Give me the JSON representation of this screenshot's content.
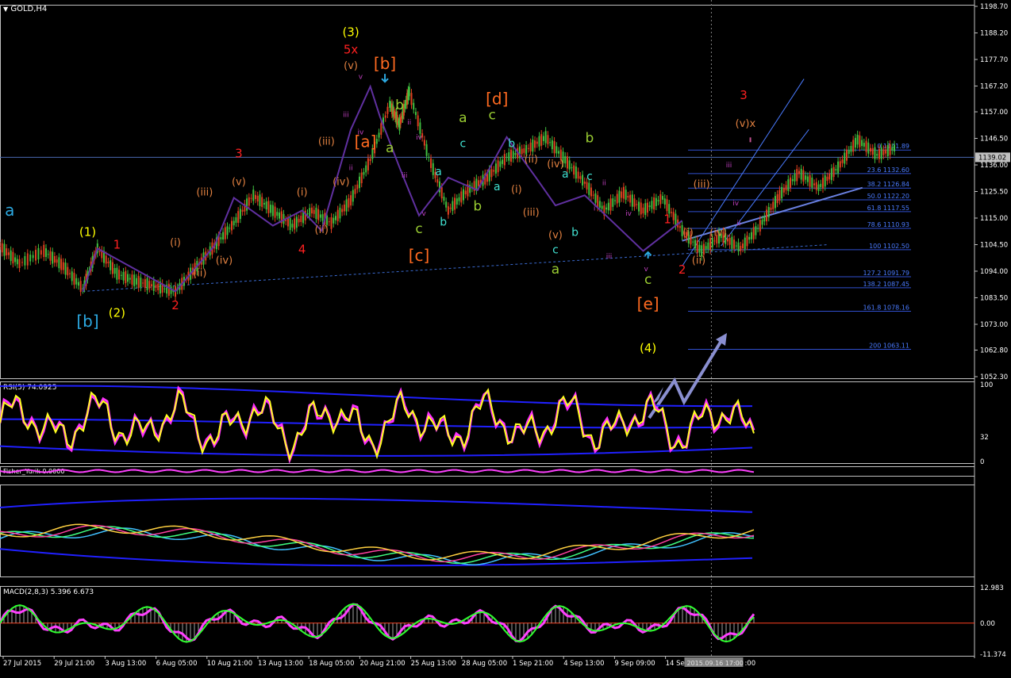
{
  "chart_data": [
    {
      "type": "line",
      "title": "GOLD,H4",
      "symbol": "GOLD",
      "timeframe": "H4",
      "price_axis": {
        "labels": [
          "1198.70",
          "1188.20",
          "1177.70",
          "1167.20",
          "1157.00",
          "1146.50",
          "1136.00",
          "1125.50",
          "1115.00",
          "1104.50",
          "1094.00",
          "1083.50",
          "1073.00",
          "1062.80",
          "1052.30"
        ],
        "min": 1052.3,
        "max": 1198.7
      },
      "current_price": "1139.02",
      "time_axis_labels": [
        "27 Jul 2015",
        "29 Jul 21:00",
        "3 Aug 13:00",
        "6 Aug 05:00",
        "10 Aug 21:00",
        "13 Aug 13:00",
        "18 Aug 05:00",
        "20 Aug 21:00",
        "25 Aug 13:00",
        "28 Aug 05:00",
        "1 Sep 21:00",
        "4 Sep 13:00",
        "9 Sep 09:00",
        "14 Sep"
      ],
      "cursor_time": "2015.09.16 17:00",
      "cursor_time_tail": ":00",
      "fibonacci_levels": [
        {
          "ratio": "0",
          "price": "1141.89"
        },
        {
          "ratio": "23.6",
          "price": "1132.60"
        },
        {
          "ratio": "38.2",
          "price": "1126.84"
        },
        {
          "ratio": "50.0",
          "price": "1122.20"
        },
        {
          "ratio": "61.8",
          "price": "1117.55"
        },
        {
          "ratio": "78.6",
          "price": "1110.93"
        },
        {
          "ratio": "100",
          "price": "1102.50"
        },
        {
          "ratio": "127.2",
          "price": "1091.79"
        },
        {
          "ratio": "138.2",
          "price": "1087.45"
        },
        {
          "ratio": "161.8",
          "price": "1078.16"
        },
        {
          "ratio": "200",
          "price": "1063.11"
        }
      ],
      "price_series": [
        {
          "t": 0,
          "p": 1104
        },
        {
          "t": 0.02,
          "p": 1097
        },
        {
          "t": 0.045,
          "p": 1102
        },
        {
          "t": 0.065,
          "p": 1096
        },
        {
          "t": 0.085,
          "p": 1087
        },
        {
          "t": 0.1,
          "p": 1103
        },
        {
          "t": 0.12,
          "p": 1093
        },
        {
          "t": 0.14,
          "p": 1090
        },
        {
          "t": 0.16,
          "p": 1088
        },
        {
          "t": 0.18,
          "p": 1086
        },
        {
          "t": 0.2,
          "p": 1095
        },
        {
          "t": 0.22,
          "p": 1104
        },
        {
          "t": 0.24,
          "p": 1113
        },
        {
          "t": 0.26,
          "p": 1124
        },
        {
          "t": 0.28,
          "p": 1118
        },
        {
          "t": 0.3,
          "p": 1112
        },
        {
          "t": 0.32,
          "p": 1118
        },
        {
          "t": 0.34,
          "p": 1113
        },
        {
          "t": 0.36,
          "p": 1122
        },
        {
          "t": 0.38,
          "p": 1138
        },
        {
          "t": 0.4,
          "p": 1160
        },
        {
          "t": 0.41,
          "p": 1152
        },
        {
          "t": 0.42,
          "p": 1165
        },
        {
          "t": 0.44,
          "p": 1139
        },
        {
          "t": 0.46,
          "p": 1118
        },
        {
          "t": 0.48,
          "p": 1126
        },
        {
          "t": 0.5,
          "p": 1131
        },
        {
          "t": 0.52,
          "p": 1139
        },
        {
          "t": 0.54,
          "p": 1142
        },
        {
          "t": 0.56,
          "p": 1147
        },
        {
          "t": 0.58,
          "p": 1138
        },
        {
          "t": 0.6,
          "p": 1129
        },
        {
          "t": 0.62,
          "p": 1118
        },
        {
          "t": 0.64,
          "p": 1125
        },
        {
          "t": 0.66,
          "p": 1118
        },
        {
          "t": 0.68,
          "p": 1123
        },
        {
          "t": 0.7,
          "p": 1110
        },
        {
          "t": 0.72,
          "p": 1102
        },
        {
          "t": 0.74,
          "p": 1108
        },
        {
          "t": 0.76,
          "p": 1103
        },
        {
          "t": 0.78,
          "p": 1112
        },
        {
          "t": 0.8,
          "p": 1124
        },
        {
          "t": 0.82,
          "p": 1133
        },
        {
          "t": 0.84,
          "p": 1127
        },
        {
          "t": 0.86,
          "p": 1135
        },
        {
          "t": 0.88,
          "p": 1146
        },
        {
          "t": 0.9,
          "p": 1140
        },
        {
          "t": 0.92,
          "p": 1143
        }
      ],
      "wave_labels": [
        {
          "text": "a",
          "color": "#2ca9e1",
          "t": 0.01,
          "p": 1116,
          "size": 20
        },
        {
          "text": "[b]",
          "color": "#2ca9e1",
          "t": 0.09,
          "p": 1072,
          "size": 20
        },
        {
          "text": "(1)",
          "color": "#ffff00",
          "t": 0.09,
          "p": 1108,
          "size": 15
        },
        {
          "text": "(2)",
          "color": "#ffff00",
          "t": 0.12,
          "p": 1076,
          "size": 15
        },
        {
          "text": "1",
          "color": "#ff2020",
          "t": 0.12,
          "p": 1103,
          "size": 15
        },
        {
          "text": "2",
          "color": "#ff2020",
          "t": 0.18,
          "p": 1079,
          "size": 15
        },
        {
          "text": "(i)",
          "color": "#e08040",
          "t": 0.18,
          "p": 1104,
          "size": 13
        },
        {
          "text": "(ii)",
          "color": "#e08040",
          "t": 0.205,
          "p": 1092,
          "size": 13
        },
        {
          "text": "(iii)",
          "color": "#e08040",
          "t": 0.21,
          "p": 1124,
          "size": 13
        },
        {
          "text": "(iv)",
          "color": "#e08040",
          "t": 0.23,
          "p": 1097,
          "size": 13
        },
        {
          "text": "3",
          "color": "#ff2020",
          "t": 0.245,
          "p": 1139,
          "size": 15
        },
        {
          "text": "(v)",
          "color": "#e08040",
          "t": 0.245,
          "p": 1128,
          "size": 13
        },
        {
          "text": "4",
          "color": "#ff2020",
          "t": 0.31,
          "p": 1101,
          "size": 15
        },
        {
          "text": "(i)",
          "color": "#e08040",
          "t": 0.31,
          "p": 1124,
          "size": 13
        },
        {
          "text": "(ii)",
          "color": "#e08040",
          "t": 0.33,
          "p": 1109,
          "size": 13
        },
        {
          "text": "(iii)",
          "color": "#e08040",
          "t": 0.335,
          "p": 1144,
          "size": 13
        },
        {
          "text": "(iv)",
          "color": "#e08040",
          "t": 0.35,
          "p": 1128,
          "size": 13
        },
        {
          "text": "(3)",
          "color": "#ffff00",
          "t": 0.36,
          "p": 1187,
          "size": 15
        },
        {
          "text": "5x",
          "color": "#ff2020",
          "t": 0.36,
          "p": 1180,
          "size": 15
        },
        {
          "text": "(v)",
          "color": "#e08040",
          "t": 0.36,
          "p": 1174,
          "size": 13
        },
        {
          "text": "[b]",
          "color": "#ff6a20",
          "t": 0.395,
          "p": 1174,
          "size": 20
        },
        {
          "text": "[a]",
          "color": "#ff6a20",
          "t": 0.375,
          "p": 1143,
          "size": 20
        },
        {
          "text": "b",
          "color": "#9acd32",
          "t": 0.41,
          "p": 1158,
          "size": 17
        },
        {
          "text": "a",
          "color": "#9acd32",
          "t": 0.4,
          "p": 1141,
          "size": 17
        },
        {
          "text": "c",
          "color": "#9acd32",
          "t": 0.43,
          "p": 1109,
          "size": 17
        },
        {
          "text": "[c]",
          "color": "#ff6a20",
          "t": 0.43,
          "p": 1098,
          "size": 20
        },
        {
          "text": "a",
          "color": "#40e0d0",
          "t": 0.45,
          "p": 1132,
          "size": 14
        },
        {
          "text": "b",
          "color": "#40e0d0",
          "t": 0.455,
          "p": 1112,
          "size": 14
        },
        {
          "text": "a",
          "color": "#9acd32",
          "t": 0.475,
          "p": 1153,
          "size": 17
        },
        {
          "text": "c",
          "color": "#40e0d0",
          "t": 0.475,
          "p": 1143,
          "size": 14
        },
        {
          "text": "b",
          "color": "#9acd32",
          "t": 0.49,
          "p": 1118,
          "size": 17
        },
        {
          "text": "[d]",
          "color": "#ff6a20",
          "t": 0.51,
          "p": 1160,
          "size": 20
        },
        {
          "text": "c",
          "color": "#9acd32",
          "t": 0.505,
          "p": 1154,
          "size": 17
        },
        {
          "text": "b",
          "color": "#40e0d0",
          "t": 0.525,
          "p": 1143,
          "size": 14
        },
        {
          "text": "a",
          "color": "#40e0d0",
          "t": 0.51,
          "p": 1126,
          "size": 14
        },
        {
          "text": "(ii)",
          "color": "#e08040",
          "t": 0.545,
          "p": 1137,
          "size": 13
        },
        {
          "text": "(iv)",
          "color": "#e08040",
          "t": 0.57,
          "p": 1135,
          "size": 13
        },
        {
          "text": "(i)",
          "color": "#e08040",
          "t": 0.53,
          "p": 1125,
          "size": 13
        },
        {
          "text": "(iii)",
          "color": "#e08040",
          "t": 0.545,
          "p": 1116,
          "size": 13
        },
        {
          "text": "(v)",
          "color": "#e08040",
          "t": 0.57,
          "p": 1107,
          "size": 13
        },
        {
          "text": "b",
          "color": "#9acd32",
          "t": 0.605,
          "p": 1145,
          "size": 17
        },
        {
          "text": "c",
          "color": "#40e0d0",
          "t": 0.605,
          "p": 1130,
          "size": 14
        },
        {
          "text": "a",
          "color": "#40e0d0",
          "t": 0.58,
          "p": 1131,
          "size": 14
        },
        {
          "text": "b",
          "color": "#40e0d0",
          "t": 0.59,
          "p": 1108,
          "size": 14
        },
        {
          "text": "c",
          "color": "#40e0d0",
          "t": 0.57,
          "p": 1101,
          "size": 14
        },
        {
          "text": "a",
          "color": "#9acd32",
          "t": 0.57,
          "p": 1093,
          "size": 17
        },
        {
          "text": "c",
          "color": "#9acd32",
          "t": 0.665,
          "p": 1089,
          "size": 17
        },
        {
          "text": "[e]",
          "color": "#ff6a20",
          "t": 0.665,
          "p": 1079,
          "size": 20
        },
        {
          "text": "(4)",
          "color": "#ffff00",
          "t": 0.665,
          "p": 1062,
          "size": 15
        },
        {
          "text": "1",
          "color": "#ff2020",
          "t": 0.685,
          "p": 1113,
          "size": 15
        },
        {
          "text": "2",
          "color": "#ff2020",
          "t": 0.7,
          "p": 1093,
          "size": 15
        },
        {
          "text": "(i)",
          "color": "#e08040",
          "t": 0.706,
          "p": 1108,
          "size": 13
        },
        {
          "text": "(ii)",
          "color": "#e08040",
          "t": 0.717,
          "p": 1097,
          "size": 13
        },
        {
          "text": "(iii)",
          "color": "#e08040",
          "t": 0.72,
          "p": 1127,
          "size": 13
        },
        {
          "text": "(iv)",
          "color": "#e08040",
          "t": 0.737,
          "p": 1108,
          "size": 13
        },
        {
          "text": "3",
          "color": "#ff2020",
          "t": 0.763,
          "p": 1162,
          "size": 15
        },
        {
          "text": "(v)x",
          "color": "#e08040",
          "t": 0.765,
          "p": 1151,
          "size": 13
        }
      ],
      "small_labels": [
        {
          "text": "v",
          "color": "#c040c0",
          "t": 0.37,
          "p": 1170
        },
        {
          "text": "iii",
          "color": "#c040c0",
          "t": 0.355,
          "p": 1155
        },
        {
          "text": "ii",
          "color": "#c040c0",
          "t": 0.36,
          "p": 1134
        },
        {
          "text": "iv",
          "color": "#c040c0",
          "t": 0.37,
          "p": 1148
        },
        {
          "text": "ii",
          "color": "#c040c0",
          "t": 0.42,
          "p": 1152
        },
        {
          "text": "iv",
          "color": "#c040c0",
          "t": 0.43,
          "p": 1146
        },
        {
          "text": "iii",
          "color": "#c040c0",
          "t": 0.415,
          "p": 1131
        },
        {
          "text": "v",
          "color": "#c040c0",
          "t": 0.435,
          "p": 1116
        },
        {
          "text": "ii",
          "color": "#c040c0",
          "t": 0.62,
          "p": 1128
        },
        {
          "text": "iv",
          "color": "#c040c0",
          "t": 0.645,
          "p": 1116
        },
        {
          "text": "iii",
          "color": "#c040c0",
          "t": 0.625,
          "p": 1099
        },
        {
          "text": "v",
          "color": "#c040c0",
          "t": 0.663,
          "p": 1094
        },
        {
          "text": "iii",
          "color": "#c040c0",
          "t": 0.748,
          "p": 1135
        },
        {
          "text": "iv",
          "color": "#c040c0",
          "t": 0.755,
          "p": 1120
        },
        {
          "text": "ii",
          "color": "#c040c0",
          "t": 0.758,
          "p": 1112
        },
        {
          "text": "i",
          "color": "#c040c0",
          "t": 0.61,
          "p": 1118
        }
      ],
      "rsi": {
        "label": "RSI(5) 74.0925",
        "levels": [
          "100",
          "32",
          "0"
        ]
      },
      "indicator2_label": "Fisher_Yurik 0.0000",
      "macd": {
        "label": "MACD(2,8,3) 5.396 6.673",
        "levels": [
          "12.983",
          "0.00",
          "-11.374"
        ]
      }
    }
  ]
}
